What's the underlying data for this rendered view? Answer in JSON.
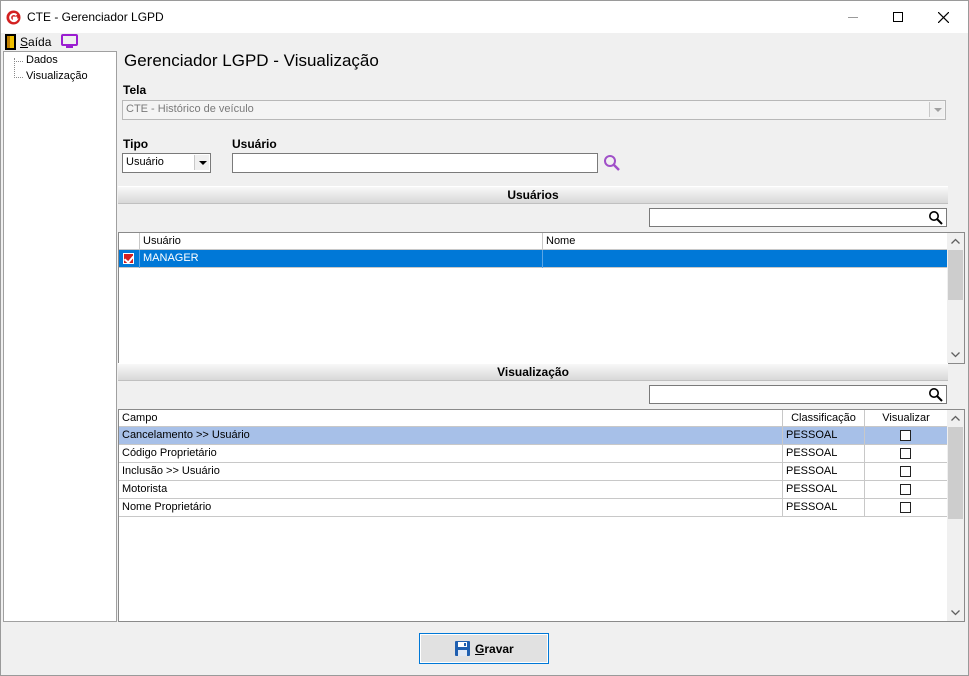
{
  "window": {
    "title": "CTE - Gerenciador LGPD"
  },
  "menu": {
    "exit_label_u": "S",
    "exit_label_rest": "aída"
  },
  "tree": {
    "items": [
      "Dados",
      "Visualização"
    ]
  },
  "page": {
    "title": "Gerenciador LGPD - Visualização"
  },
  "form": {
    "tela_label": "Tela",
    "tela_value": "CTE - Histórico de veículo",
    "tipo_label": "Tipo",
    "tipo_value": "Usuário",
    "usuario_label": "Usuário",
    "usuario_value": ""
  },
  "users_section": {
    "header": "Usuários",
    "filter_value": "",
    "columns": [
      "Usuário",
      "Nome"
    ],
    "rows": [
      {
        "checked": true,
        "usuario": "MANAGER",
        "nome": ""
      }
    ]
  },
  "view_section": {
    "header": "Visualização",
    "filter_value": "",
    "columns": [
      "Campo",
      "Classificação",
      "Visualizar"
    ],
    "rows": [
      {
        "campo": "Cancelamento >> Usuário",
        "classificacao": "PESSOAL",
        "visualizar": false
      },
      {
        "campo": "Código Proprietário",
        "classificacao": "PESSOAL",
        "visualizar": false
      },
      {
        "campo": "Inclusão >> Usuário",
        "classificacao": "PESSOAL",
        "visualizar": false
      },
      {
        "campo": "Motorista",
        "classificacao": "PESSOAL",
        "visualizar": false
      },
      {
        "campo": "Nome Proprietário",
        "classificacao": "PESSOAL",
        "visualizar": false
      }
    ]
  },
  "actions": {
    "save_label_u": "G",
    "save_label_rest": "ravar"
  },
  "colors": {
    "selection": "#0078d7",
    "highlight_row": "#a7c0e8",
    "app_icon": "#d32020",
    "search_icon": "#a050c8"
  }
}
